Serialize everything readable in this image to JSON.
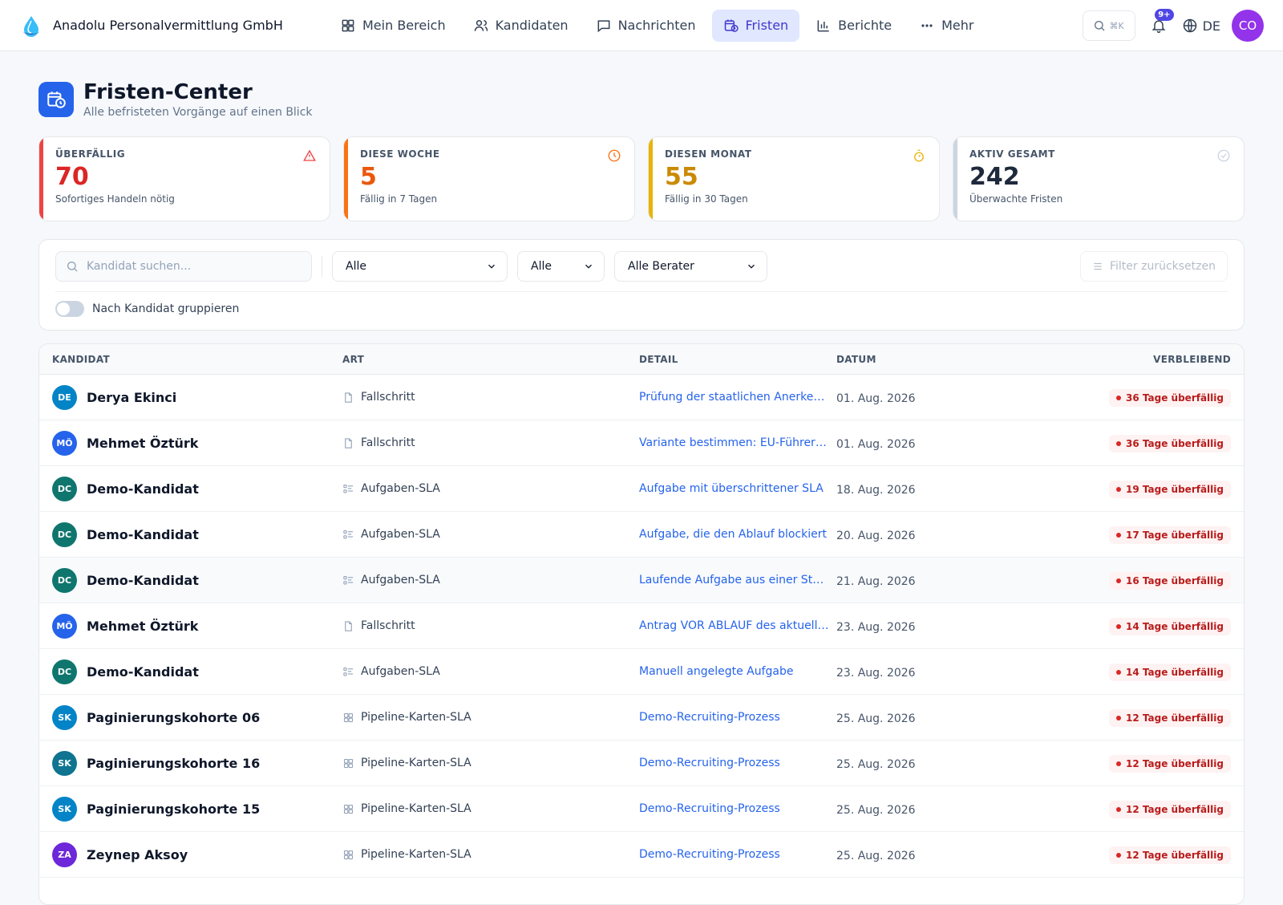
{
  "brand": {
    "name": "Anadolu Personalvermittlung GmbH"
  },
  "nav": [
    {
      "label": "Mein Bereich",
      "icon": "grid-icon",
      "active": false
    },
    {
      "label": "Kandidaten",
      "icon": "users-icon",
      "active": false
    },
    {
      "label": "Nachrichten",
      "icon": "message-icon",
      "active": false
    },
    {
      "label": "Fristen",
      "icon": "calendar-clock-icon",
      "active": true
    },
    {
      "label": "Berichte",
      "icon": "bar-chart-icon",
      "active": false
    },
    {
      "label": "Mehr",
      "icon": "more-icon",
      "active": false
    }
  ],
  "topbar": {
    "search_shortcut": "⌘K",
    "notification_badge": "9+",
    "language": "DE",
    "avatar_initials": "CO"
  },
  "page": {
    "title": "Fristen-Center",
    "subtitle": "Alle befristeten Vorgänge auf einen Blick"
  },
  "stats": [
    {
      "label": "ÜBERFÄLLIG",
      "value": "70",
      "hint": "Sofortiges Handeln nötig",
      "accent": "#ef4444",
      "text": "#dc2626",
      "icon": "warning-icon"
    },
    {
      "label": "DIESE WOCHE",
      "value": "5",
      "hint": "Fällig in 7 Tagen",
      "accent": "#f97316",
      "text": "#ea580c",
      "icon": "clock-icon"
    },
    {
      "label": "DIESEN MONAT",
      "value": "55",
      "hint": "Fällig in 30 Tagen",
      "accent": "#eab308",
      "text": "#ca8a04",
      "icon": "timer-icon"
    },
    {
      "label": "AKTIV GESAMT",
      "value": "242",
      "hint": "Überwachte Fristen",
      "accent": "#cbd5e1",
      "text": "#1e293b",
      "icon": "check-circle-icon"
    }
  ],
  "filters": {
    "search_placeholder": "Kandidat suchen...",
    "type_select": "Alle",
    "status_select": "Alle",
    "advisor_select": "Alle Berater",
    "reset_label": "Filter zurücksetzen",
    "group_toggle_label": "Nach Kandidat gruppieren"
  },
  "table": {
    "headers": {
      "candidate": "KANDIDAT",
      "type": "ART",
      "detail": "DETAIL",
      "date": "DATUM",
      "remaining": "VERBLEIBEND"
    },
    "rows": [
      {
        "initials": "DE",
        "avatar_color": "#0284c7",
        "name": "Derya Ekinci",
        "type": "Fallschritt",
        "type_icon": "file-icon",
        "detail": "Prüfung der staatlichen Anerkennung",
        "date": "01. Aug. 2026",
        "remaining": "36 Tage überfällig"
      },
      {
        "initials": "MÖ",
        "avatar_color": "#2563eb",
        "name": "Mehmet Öztürk",
        "type": "Fallschritt",
        "type_icon": "file-icon",
        "detail": "Variante bestimmen: EU-Führerschein",
        "date": "01. Aug. 2026",
        "remaining": "36 Tage überfällig"
      },
      {
        "initials": "DC",
        "avatar_color": "#0f766e",
        "name": "Demo-Kandidat",
        "type": "Aufgaben-SLA",
        "type_icon": "task-list-icon",
        "detail": "Aufgabe mit überschrittener SLA",
        "date": "18. Aug. 2026",
        "remaining": "19 Tage überfällig"
      },
      {
        "initials": "DC",
        "avatar_color": "#0f766e",
        "name": "Demo-Kandidat",
        "type": "Aufgaben-SLA",
        "type_icon": "task-list-icon",
        "detail": "Aufgabe, die den Ablauf blockiert",
        "date": "20. Aug. 2026",
        "remaining": "17 Tage überfällig"
      },
      {
        "initials": "DC",
        "avatar_color": "#0f766e",
        "name": "Demo-Kandidat",
        "type": "Aufgaben-SLA",
        "type_icon": "task-list-icon",
        "detail": "Laufende Aufgabe aus einer Stufe",
        "date": "21. Aug. 2026",
        "remaining": "16 Tage überfällig",
        "highlight": true
      },
      {
        "initials": "MÖ",
        "avatar_color": "#2563eb",
        "name": "Mehmet Öztürk",
        "type": "Fallschritt",
        "type_icon": "file-icon",
        "detail": "Antrag VOR ABLAUF des aktuellen",
        "date": "23. Aug. 2026",
        "remaining": "14 Tage überfällig"
      },
      {
        "initials": "DC",
        "avatar_color": "#0f766e",
        "name": "Demo-Kandidat",
        "type": "Aufgaben-SLA",
        "type_icon": "task-list-icon",
        "detail": "Manuell angelegte Aufgabe",
        "date": "23. Aug. 2026",
        "remaining": "14 Tage überfällig"
      },
      {
        "initials": "SK",
        "avatar_color": "#0284c7",
        "name": "Paginierungskohorte 06",
        "type": "Pipeline-Karten-SLA",
        "type_icon": "kanban-icon",
        "detail": "Demo-Recruiting-Prozess",
        "date": "25. Aug. 2026",
        "remaining": "12 Tage überfällig"
      },
      {
        "initials": "SK",
        "avatar_color": "#0e7490",
        "name": "Paginierungskohorte 16",
        "type": "Pipeline-Karten-SLA",
        "type_icon": "kanban-icon",
        "detail": "Demo-Recruiting-Prozess",
        "date": "25. Aug. 2026",
        "remaining": "12 Tage überfällig"
      },
      {
        "initials": "SK",
        "avatar_color": "#0284c7",
        "name": "Paginierungskohorte 15",
        "type": "Pipeline-Karten-SLA",
        "type_icon": "kanban-icon",
        "detail": "Demo-Recruiting-Prozess",
        "date": "25. Aug. 2026",
        "remaining": "12 Tage überfällig"
      },
      {
        "initials": "ZA",
        "avatar_color": "#6d28d9",
        "name": "Zeynep Aksoy",
        "type": "Pipeline-Karten-SLA",
        "type_icon": "kanban-icon",
        "detail": "Demo-Recruiting-Prozess",
        "date": "25. Aug. 2026",
        "remaining": "12 Tage überfällig"
      }
    ]
  }
}
